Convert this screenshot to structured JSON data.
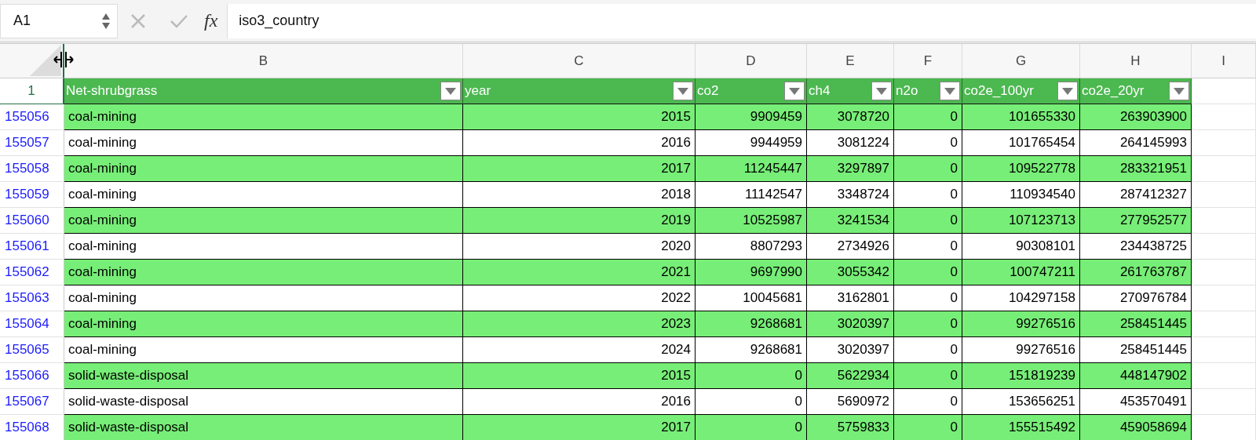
{
  "formula_bar": {
    "cell_ref": "A1",
    "function_label": "fx",
    "value": "iso3_country"
  },
  "column_letters": [
    "B",
    "C",
    "D",
    "E",
    "F",
    "G",
    "H",
    "I"
  ],
  "header_row": {
    "number": "1",
    "cells": [
      "Net-shrubgrass",
      "year",
      "co2",
      "ch4",
      "n2o",
      "co2e_100yr",
      "co2e_20yr"
    ]
  },
  "rows": [
    {
      "number": "155056",
      "banded": true,
      "cells": [
        "coal-mining",
        "2015",
        "9909459",
        "3078720",
        "0",
        "101655330",
        "263903900"
      ]
    },
    {
      "number": "155057",
      "banded": false,
      "cells": [
        "coal-mining",
        "2016",
        "9944959",
        "3081224",
        "0",
        "101765454",
        "264145993"
      ]
    },
    {
      "number": "155058",
      "banded": true,
      "cells": [
        "coal-mining",
        "2017",
        "11245447",
        "3297897",
        "0",
        "109522778",
        "283321951"
      ]
    },
    {
      "number": "155059",
      "banded": false,
      "cells": [
        "coal-mining",
        "2018",
        "11142547",
        "3348724",
        "0",
        "110934540",
        "287412327"
      ]
    },
    {
      "number": "155060",
      "banded": true,
      "cells": [
        "coal-mining",
        "2019",
        "10525987",
        "3241534",
        "0",
        "107123713",
        "277952577"
      ]
    },
    {
      "number": "155061",
      "banded": false,
      "cells": [
        "coal-mining",
        "2020",
        "8807293",
        "2734926",
        "0",
        "90308101",
        "234438725"
      ]
    },
    {
      "number": "155062",
      "banded": true,
      "cells": [
        "coal-mining",
        "2021",
        "9697990",
        "3055342",
        "0",
        "100747211",
        "261763787"
      ]
    },
    {
      "number": "155063",
      "banded": false,
      "cells": [
        "coal-mining",
        "2022",
        "10045681",
        "3162801",
        "0",
        "104297158",
        "270976784"
      ]
    },
    {
      "number": "155064",
      "banded": true,
      "cells": [
        "coal-mining",
        "2023",
        "9268681",
        "3020397",
        "0",
        "99276516",
        "258451445"
      ]
    },
    {
      "number": "155065",
      "banded": false,
      "cells": [
        "coal-mining",
        "2024",
        "9268681",
        "3020397",
        "0",
        "99276516",
        "258451445"
      ]
    },
    {
      "number": "155066",
      "banded": true,
      "cells": [
        "solid-waste-disposal",
        "2015",
        "0",
        "5622934",
        "0",
        "151819239",
        "448147902"
      ]
    },
    {
      "number": "155067",
      "banded": false,
      "cells": [
        "solid-waste-disposal",
        "2016",
        "0",
        "5690972",
        "0",
        "153656251",
        "453570491"
      ]
    },
    {
      "number": "155068",
      "banded": true,
      "cells": [
        "solid-waste-disposal",
        "2017",
        "0",
        "5759833",
        "0",
        "155515492",
        "459058694"
      ]
    }
  ]
}
